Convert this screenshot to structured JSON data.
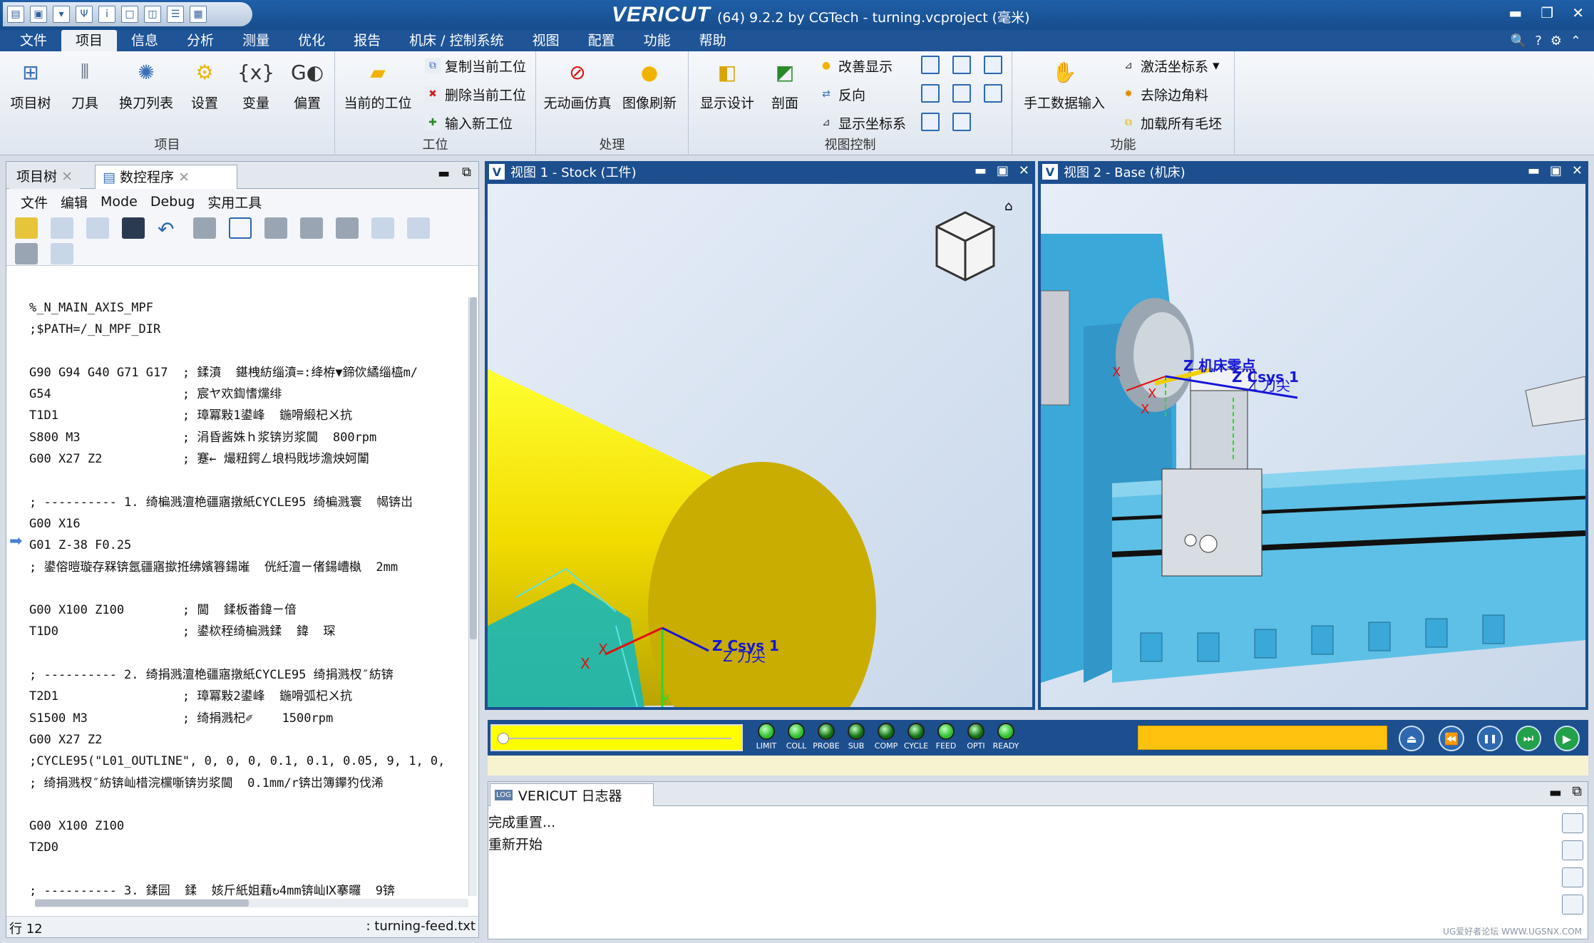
{
  "titlebar": {
    "brand": "VERICUT",
    "title": "(64)  9.2.2 by CGTech - turning.vcproject (毫米)",
    "controls": [
      "▬",
      "❐",
      "✕"
    ]
  },
  "menu": {
    "items": [
      "文件",
      "项目",
      "信息",
      "分析",
      "测量",
      "优化",
      "报告",
      "机床 / 控制系统",
      "视图",
      "配置",
      "功能",
      "帮助"
    ],
    "active": "项目",
    "right_icons": [
      "search-icon",
      "help-icon",
      "settings-icon",
      "collapse-icon"
    ],
    "right_glyphs": [
      "🔍",
      "?",
      "⚙",
      "⌃"
    ]
  },
  "ribbon": {
    "groups": [
      {
        "label": "项目",
        "buttons": [
          "项目树",
          "刀具",
          "换刀列表",
          "设置",
          "变量",
          "偏置"
        ]
      },
      {
        "label": "工位",
        "big": "当前的工位",
        "small": [
          "复制当前工位",
          "删除当前工位",
          "输入新工位"
        ]
      },
      {
        "label": "处理",
        "buttons": [
          "无动画仿真",
          "图像刷新"
        ]
      },
      {
        "label": "视图控制",
        "buttons": [
          "显示设计",
          "剖面"
        ],
        "small": [
          "改善显示",
          "反向",
          "显示坐标系"
        ]
      },
      {
        "label": "功能",
        "big": "手工数据输入",
        "small": [
          "激活坐标系",
          "去除边角料",
          "加载所有毛坯"
        ]
      }
    ]
  },
  "leftpanel": {
    "tabs": [
      "项目树",
      "数控程序"
    ],
    "submenu": [
      "文件",
      "编辑",
      "Mode",
      "Debug",
      "实用工具"
    ],
    "code": [
      "%_N_MAIN_AXIS_MPF",
      ";$PATH=/_N_MPF_DIR",
      "",
      "G90 G94 G40 G71 G17  ; 鍒濆  鍖栧紡缁濆=:绛栫▼鍗佽繘缁橀m/",
      "G54                  ; 宸ヤ欢鍧愭爣绯",
      "T1D1                 ; 璋冪敤1鍙峰  鍦嗗緞杞ㄨ抗",
      "S800 M3              ; 涓昏酱姝ｈ浆锛岃浆閫  800rpm",
      "G00 X27 Z2           ; 蹇← 熶粈鍔ㄥ埌杩戝埗澹炴妸闈",
      "",
      "; ---------- 1. 绮楄溅澶栬疆寤撴紙CYCLE95 绮楄溅寰  幆锛岀",
      "G00 X16",
      "G01 Z-38 F0.25",
      "; 鍙傛暟璇存槑锛氬疆寤撳拰绋嬪簭鍚嶉  侊紝澶ㄧ偖鍚嶆槸  2mm",
      "",
      "G00 X100 Z100        ; 閫  鍒板畨鍏ㄧ偣",
      "T1D0                 ; 鍙栨秷绮楄溅鍒  鍏  琛",
      "",
      "; ---------- 2. 绮捐溅澶栬疆寤撴紙CYCLE95 绮捐溅杈″紡锛",
      "T2D1                 ; 璋冪敤2鍙峰  鍦嗗弧杞ㄨ抗",
      "S1500 M3             ; 绮捐溅杞✐    1500rpm",
      "G00 X27 Z2",
      ";CYCLE95(\"L01_OUTLINE\", 0, 0, 0, 0.1, 0.1, 0.05, 9, 1, 0,",
      "; 绮捐溅杈″紡锛屾棤浣欓噺锛岃浆閫  0.1mm/r锛岀簿鑻犳伐浠",
      "",
      "G00 X100 Z100",
      "T2D0",
      "",
      "; ---------- 3. 鍒囩  鍒  姟斤紙姐藉↻4mm锛屾Ⅸ搴曪  9锛"
    ],
    "status_left": "行 12",
    "status_right": ": turning-feed.txt"
  },
  "view1": {
    "title": "视图 1 - Stock (工件)",
    "label_csys": "Z Csys 1",
    "label_tip": "Z 刀尖",
    "axis_x": "X",
    "axis_y": "Y"
  },
  "view2": {
    "title": "视图 2 - Base (机床)",
    "label_zero": "Z 机床零点",
    "label_csys": "Z Csys 1",
    "label_tip": "Z 刀尖"
  },
  "simbar": {
    "leds": [
      "LIMIT",
      "COLL",
      "PROBE",
      "SUB",
      "COMP",
      "CYCLE",
      "FEED",
      "OPTI",
      "READY"
    ],
    "led_colors": [
      "#2fbf2f",
      "#2fbf2f",
      "#106f10",
      "#106f10",
      "#106f10",
      "#106f10",
      "#2fbf2f",
      "#106f10",
      "#2fbf2f"
    ],
    "playback": [
      "rewind-to-start-icon",
      "step-back-icon",
      "pause-icon",
      "step-forward-icon",
      "play-icon"
    ],
    "glyphs": [
      "⏏",
      "⏪",
      "❚❚",
      "⏭",
      "▶"
    ],
    "slider_position": 0.0
  },
  "log": {
    "tab": "VERICUT 日志器",
    "lines": [
      "完成重置...",
      "重新开始"
    ]
  },
  "watermark": "UG爱好者论坛 WWW.UGSNX.COM",
  "colors": {
    "title_blue": "#1f5496",
    "stock_yellow": "#f2dc00",
    "progress_orange": "#ffc20e",
    "slider_yellow": "#ffff00"
  }
}
